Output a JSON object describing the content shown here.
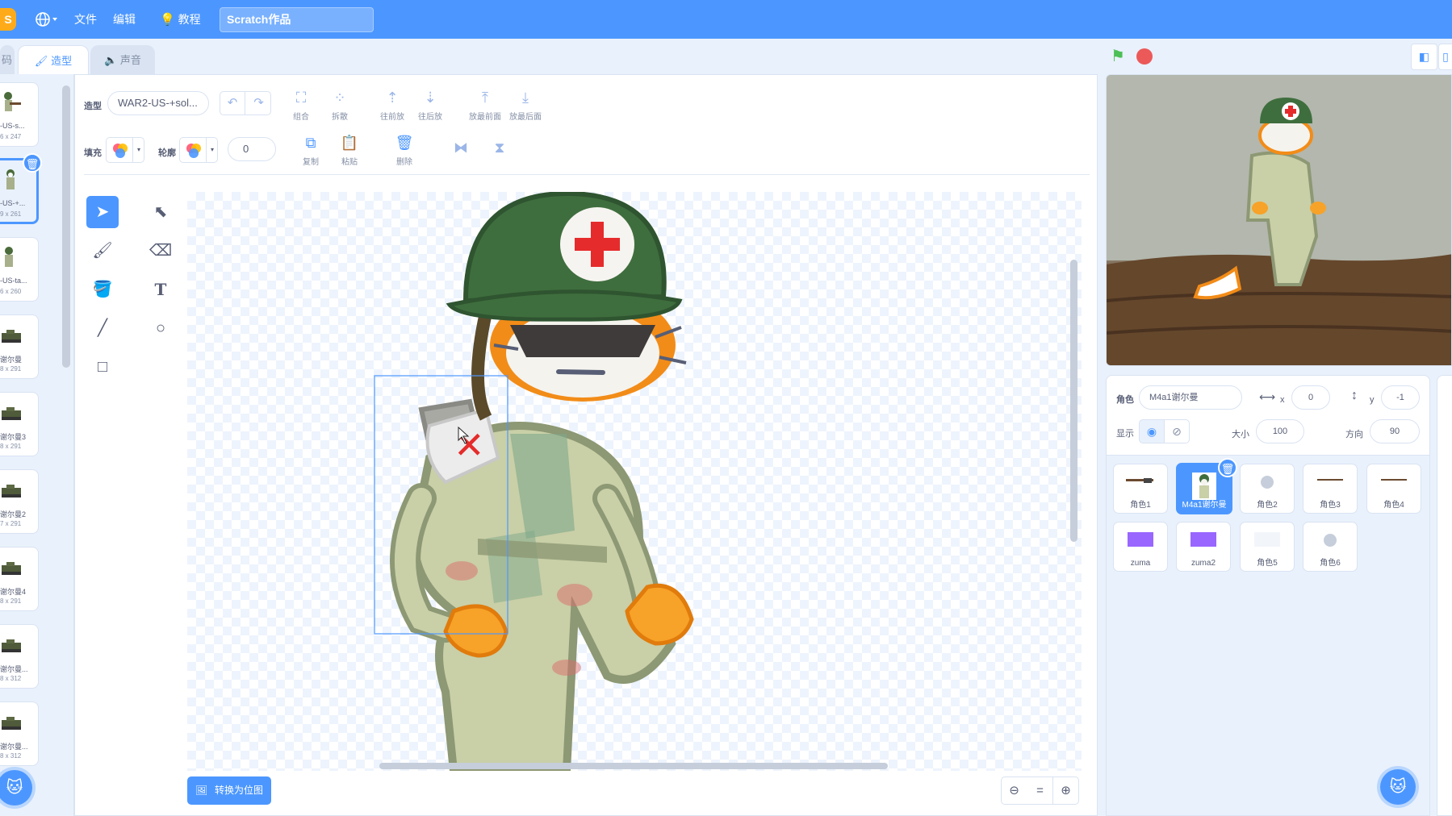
{
  "menubar": {
    "logo_text": "S",
    "file": "文件",
    "edit": "编辑",
    "tutorials": "教程",
    "project_title": "Scratch作品"
  },
  "tabs": {
    "code": "码",
    "costumes": "造型",
    "sounds": "声音"
  },
  "costumes": [
    {
      "name": "-US-s...",
      "size": "6 x 247"
    },
    {
      "name": "-US-+...",
      "size": "9 x 261"
    },
    {
      "name": "-US-ta...",
      "size": "6 x 260"
    },
    {
      "name": "谢尔曼",
      "size": "8 x 291"
    },
    {
      "name": "谢尔曼3",
      "size": "8 x 291"
    },
    {
      "name": "谢尔曼2",
      "size": "7 x 291"
    },
    {
      "name": "谢尔曼4",
      "size": "8 x 291"
    },
    {
      "name": "谢尔曼...",
      "size": "8 x 312"
    },
    {
      "name": "谢尔曼...",
      "size": "8 x 312"
    }
  ],
  "editor": {
    "costume_label": "造型",
    "costume_name": "WAR2-US-+sol...",
    "fill_label": "填充",
    "outline_label": "轮廓",
    "outline_width": "0",
    "group": "组合",
    "ungroup": "拆散",
    "forward": "往前放",
    "backward": "往后放",
    "front": "放最前面",
    "back": "放最后面",
    "copy": "复制",
    "paste": "粘贴",
    "delete": "删除",
    "convert_bitmap": "转换为位图"
  },
  "sprite_info": {
    "sprite_label": "角色",
    "sprite_name": "M4a1谢尔曼",
    "x_label": "x",
    "x_value": "0",
    "y_label": "y",
    "y_value": "-1",
    "show_label": "显示",
    "size_label": "大小",
    "size_value": "100",
    "direction_label": "方向",
    "direction_value": "90"
  },
  "sprites": [
    {
      "name": "角色1"
    },
    {
      "name": "M4a1谢尔曼"
    },
    {
      "name": "角色2"
    },
    {
      "name": "角色3"
    },
    {
      "name": "角色4"
    },
    {
      "name": "zuma"
    },
    {
      "name": "zuma2"
    },
    {
      "name": "角色5"
    },
    {
      "name": "角色6"
    }
  ],
  "colors": {
    "accent": "#4c97ff",
    "flag": "#4cbf56",
    "stop": "#ec5959"
  }
}
